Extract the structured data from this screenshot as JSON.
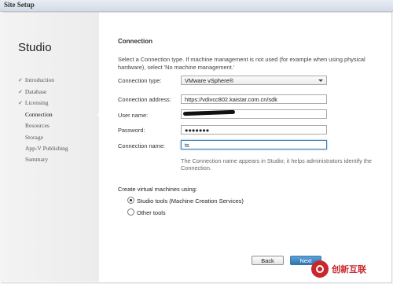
{
  "window": {
    "title": "Site Setup"
  },
  "sidebar": {
    "title": "Studio",
    "items": [
      {
        "label": "Introduction",
        "done": true
      },
      {
        "label": "Database",
        "done": true
      },
      {
        "label": "Licensing",
        "done": true
      },
      {
        "label": "Connection",
        "done": false,
        "active": true
      },
      {
        "label": "Resources",
        "done": false
      },
      {
        "label": "Storage",
        "done": false
      },
      {
        "label": "App-V Publishing",
        "done": false
      },
      {
        "label": "Summary",
        "done": false
      }
    ],
    "check_glyph": "✔"
  },
  "main": {
    "heading": "Connection",
    "description": "Select a Connection type. If machine management is not used (for example when using physical hardware), select 'No machine management.'",
    "form": {
      "connection_type": {
        "label": "Connection type:",
        "value": "VMware vSphere®"
      },
      "connection_address": {
        "label": "Connection address:",
        "value": "https://vdivcc802.kaistar.com.cn/sdk"
      },
      "user_name": {
        "label": "User name:",
        "value": ""
      },
      "password": {
        "label": "Password:",
        "value": "●●●●●●●"
      },
      "connection_name": {
        "label": "Connection name:",
        "value": "ts"
      },
      "helper": "The Connection name appears in Studio; it helps administrators identify the Connection."
    },
    "create_vms": {
      "label": "Create virtual machines using:",
      "options": [
        {
          "label": "Studio tools (Machine Creation Services)",
          "selected": true
        },
        {
          "label": "Other tools",
          "selected": false
        }
      ]
    }
  },
  "buttons": {
    "back": "Back",
    "next": "Next"
  },
  "watermark": {
    "text": "创新互联"
  },
  "colors": {
    "accent": "#2f74b3",
    "watermark": "#c8282d",
    "focus": "#3c7fb1"
  }
}
